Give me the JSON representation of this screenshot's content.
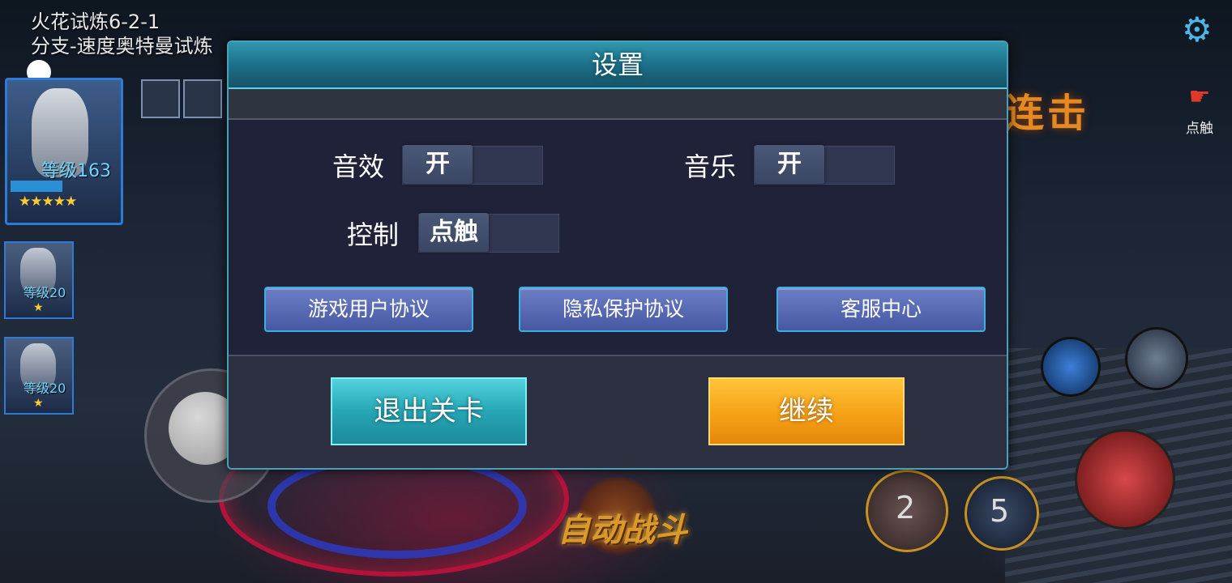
{
  "hud": {
    "stage_name": "火花试炼6-2-1",
    "stage_sub": "分支-速度奥特曼试炼",
    "hero_main_level": "等级163",
    "hero_main_stars": "★★★★★",
    "hero2_level": "等级20",
    "hero2_stars": "★",
    "hero3_level": "等级20",
    "hero3_stars": "★",
    "combo_text": "连击",
    "touch_hint": "点触",
    "skill_cd_1": "2",
    "skill_cd_2": "5",
    "auto_battle": "自动战斗",
    "settings_icon": "gear-icon"
  },
  "dialog": {
    "title": "设置",
    "sound": {
      "label": "音效",
      "value": "开"
    },
    "music": {
      "label": "音乐",
      "value": "开"
    },
    "control": {
      "label": "控制",
      "value": "点触"
    },
    "links": [
      "游戏用户协议",
      "隐私保护协议",
      "客服中心"
    ],
    "exit_label": "退出关卡",
    "continue_label": "继续"
  },
  "colors": {
    "dialog_header": "#1c6d86",
    "exit_button": "#27a6b6",
    "continue_button": "#f6a116",
    "link_button": "#4658a2"
  }
}
